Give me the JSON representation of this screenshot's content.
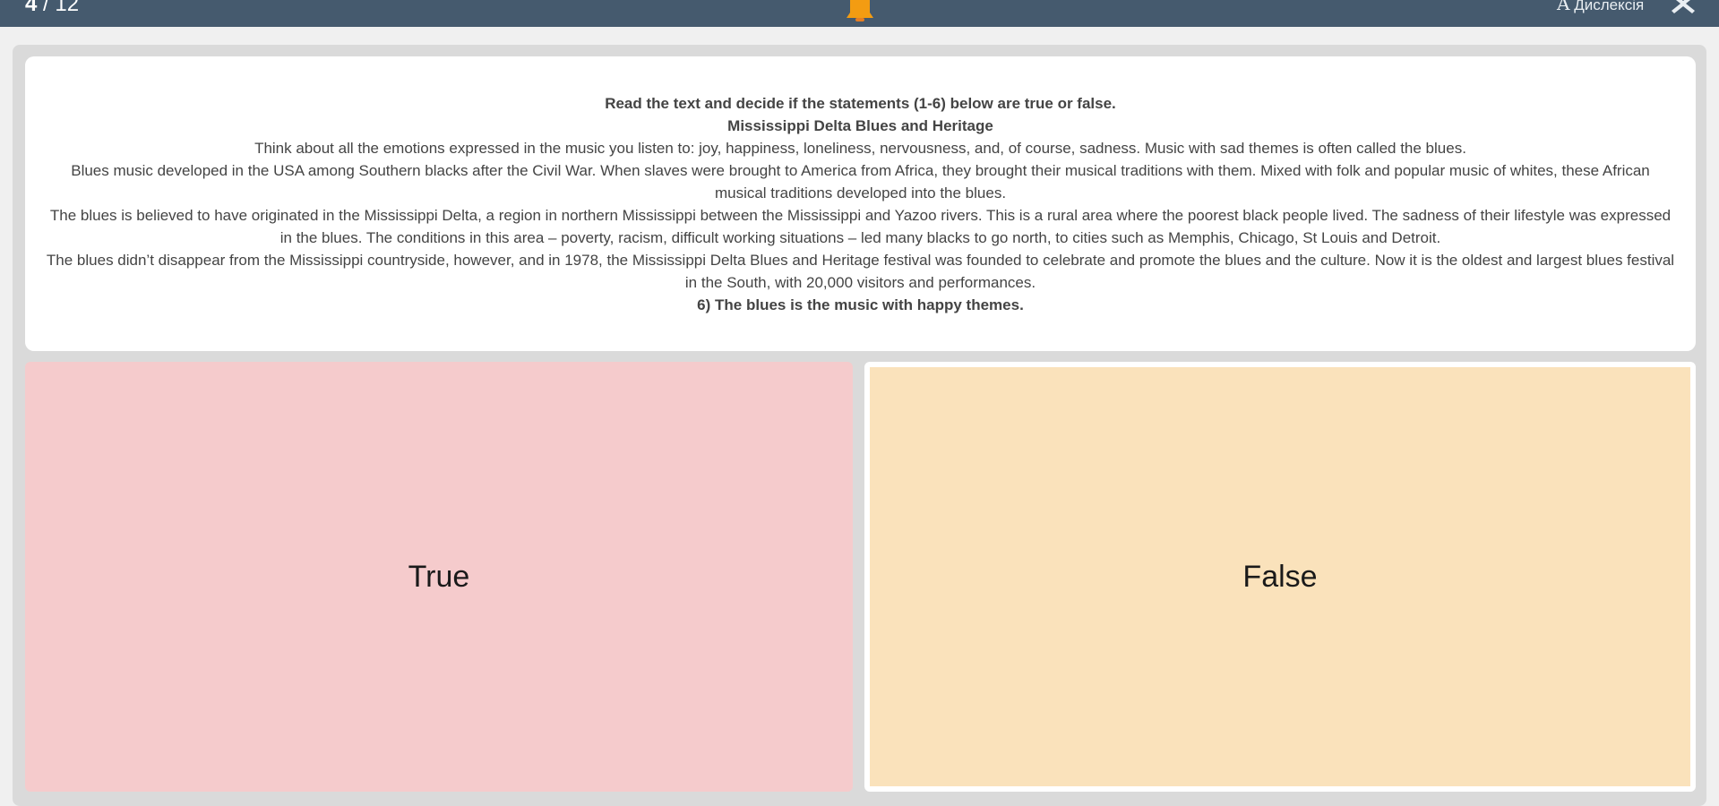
{
  "header": {
    "progress_current": "4",
    "progress_total": " / 12",
    "dyslexia_label": "Дислексія",
    "dyslexia_glyph": "A",
    "bell_icon": "bell-icon",
    "close_icon": "close-icon",
    "bar_color": "#455a6e",
    "bell_color": "#f39c12"
  },
  "question": {
    "instruction": "Read the text and decide if the statements (1-6) below are true or false.",
    "title": "Mississippi Delta Blues and Heritage",
    "paragraphs": [
      "Think about all the emotions expressed in the music you listen to: joy, happiness, loneliness, nervousness, and, of course, sadness. Music with sad themes is often called the blues.",
      "Blues music developed in the USA among Southern blacks after the Civil War. When slaves were brought to America from Africa, they brought their musical traditions with them. Mixed with folk and popular music of whites, these African musical traditions developed into the blues.",
      "The blues is believed to have originated in the Mississippi Delta, a region in northern Mississippi between the Mississippi and Yazoo rivers. This is a rural area where the poorest black people lived. The sadness of their lifestyle was expressed in the blues. The conditions in this area – poverty, racism, difficult working situations – led many blacks to go north, to cities such as Memphis, Chicago, St Louis and Detroit.",
      "The blues didn’t disappear from the Mississippi countryside, however, and in 1978, the Mississippi Delta Blues and Heritage festival was founded to celebrate and promote the blues and the culture. Now it is the oldest and largest blues festival in the South, with 20,000 visitors and performances."
    ],
    "statement": "6) The blues is the music with happy themes."
  },
  "answers": {
    "true_label": "True",
    "false_label": "False",
    "true_color": "#f5cbcc",
    "false_color": "#fae2bb"
  }
}
